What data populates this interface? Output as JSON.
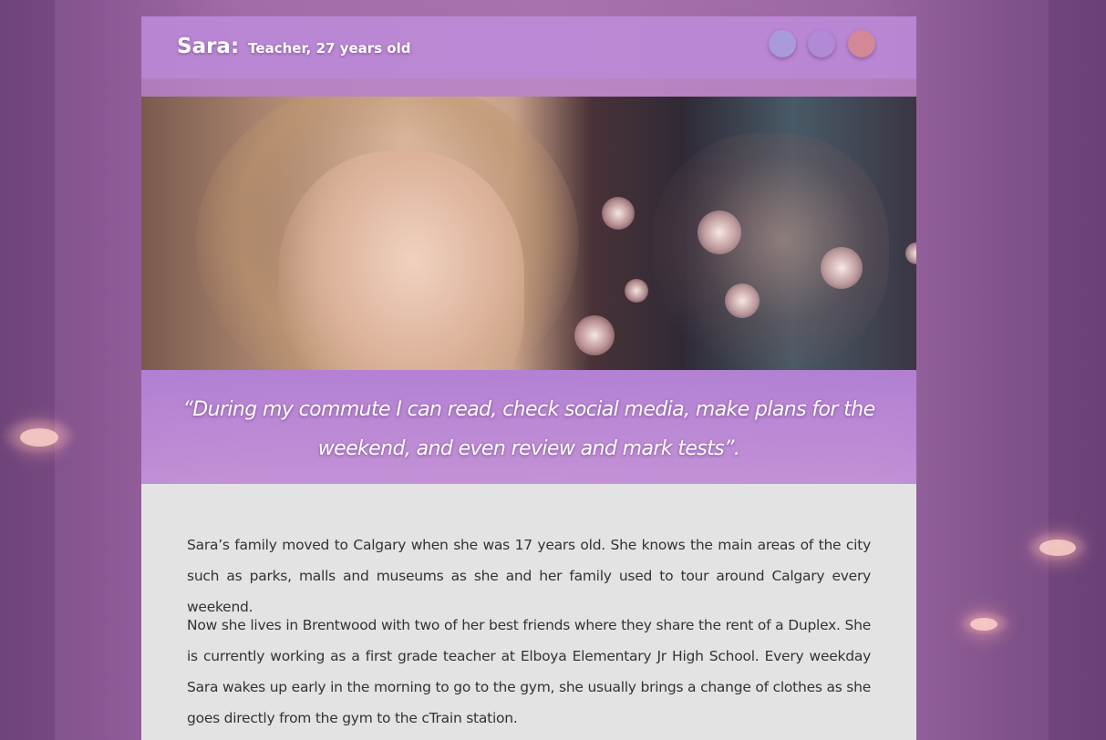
{
  "header": {
    "name": "Sara:",
    "subtitle": "Teacher, 27 years old",
    "dots": [
      "blue-dot",
      "purple-dot",
      "red-dot"
    ]
  },
  "photo": {
    "description_icon": "persona-photo"
  },
  "quote": {
    "text": "“During my commute I can read, check social media, make plans for the weekend, and even review and mark tests”."
  },
  "body": {
    "paragraphs": [
      "Sara’s family moved to Calgary when she was 17 years old. She knows the main areas of the city such as parks, malls and museums as she and her family used to tour around Calgary every weekend.",
      "Now she lives in Brentwood with two of her best friends where they share the rent of a Duplex. She is currently working as a first grade teacher at Elboya Elementary Jr High School. Every weekday Sara wakes up early in the morning to go to the gym, she usually brings a change of clothes as she goes directly from the gym to the cTrain station."
    ]
  },
  "colors": {
    "header_bg": "#be8cdc",
    "quote_bg": "#b482d7",
    "body_bg": "#e3e3e3",
    "text": "#333333",
    "dot_blue": "#a99adb",
    "dot_purple": "#b18ad6",
    "dot_red": "#d28897"
  }
}
